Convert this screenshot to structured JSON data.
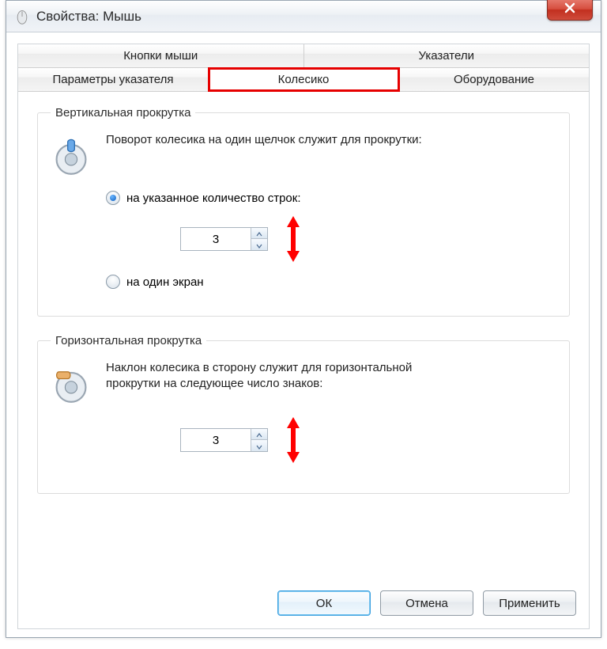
{
  "title": "Свойства: Мышь",
  "tabs_row1": [
    {
      "label": "Кнопки мыши"
    },
    {
      "label": "Указатели"
    }
  ],
  "tabs_row2": [
    {
      "label": "Параметры указателя"
    },
    {
      "label": "Колесико",
      "active": true
    },
    {
      "label": "Оборудование"
    }
  ],
  "vertical": {
    "legend": "Вертикальная прокрутка",
    "desc": "Поворот колесика на один щелчок служит для прокрутки:",
    "opt_lines": "на указанное количество строк:",
    "lines_value": "3",
    "opt_screen": "на один экран"
  },
  "horizontal": {
    "legend": "Горизонтальная прокрутка",
    "desc": "Наклон колесика в сторону служит для горизонтальной прокрутки на следующее число знаков:",
    "chars_value": "3"
  },
  "footer": {
    "ok": "ОК",
    "cancel": "Отмена",
    "apply": "Применить"
  }
}
